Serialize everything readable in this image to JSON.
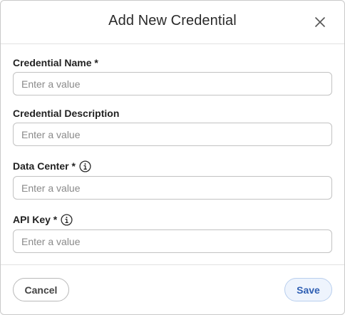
{
  "dialog": {
    "title": "Add New Credential",
    "close_icon": "close-icon"
  },
  "fields": [
    {
      "label": "Credential Name *",
      "placeholder": "Enter a value",
      "value": "",
      "info_icon": false
    },
    {
      "label": "Credential Description",
      "placeholder": "Enter a value",
      "value": "",
      "info_icon": false
    },
    {
      "label": "Data Center *",
      "placeholder": "Enter a value",
      "value": "",
      "info_icon": true
    },
    {
      "label": "API Key *",
      "placeholder": "Enter a value",
      "value": "",
      "info_icon": true
    }
  ],
  "footer": {
    "cancel_label": "Cancel",
    "save_label": "Save"
  },
  "colors": {
    "save_text": "#2f5fb3",
    "save_bg": "#eef4fd",
    "border": "#c2c2c2"
  }
}
